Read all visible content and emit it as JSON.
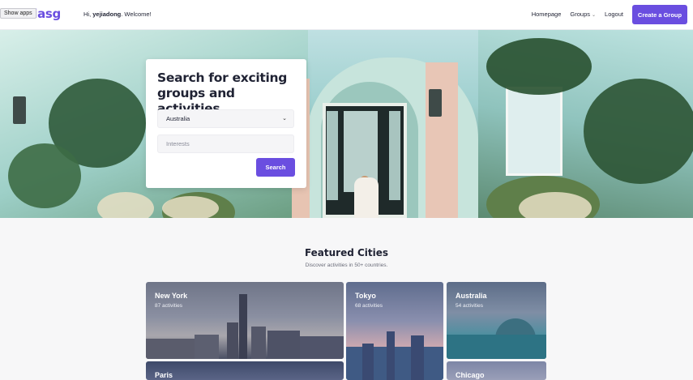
{
  "header": {
    "logo": "sociasg",
    "show_apps_tooltip": "Show apps",
    "greeting_prefix": "Hi, ",
    "username": "yejiadong",
    "greeting_suffix": ". Welcome!",
    "nav": {
      "homepage": "Homepage",
      "groups": "Groups",
      "logout": "Logout"
    },
    "create_button": "Create a Group"
  },
  "search": {
    "title": "Search for exciting groups and activities.",
    "country_value": "Australia",
    "interests_placeholder": "Interests",
    "button": "Search"
  },
  "featured": {
    "title": "Featured Cities",
    "subtitle": "Discover activities in 50+ countries.",
    "cities": [
      {
        "name": "New York",
        "count": "87 activities"
      },
      {
        "name": "Tokyo",
        "count": "68 activities"
      },
      {
        "name": "Australia",
        "count": "54 activities"
      },
      {
        "name": "Paris",
        "count": ""
      },
      {
        "name": "Chicago",
        "count": ""
      }
    ]
  },
  "colors": {
    "accent": "#6a4ee0"
  }
}
